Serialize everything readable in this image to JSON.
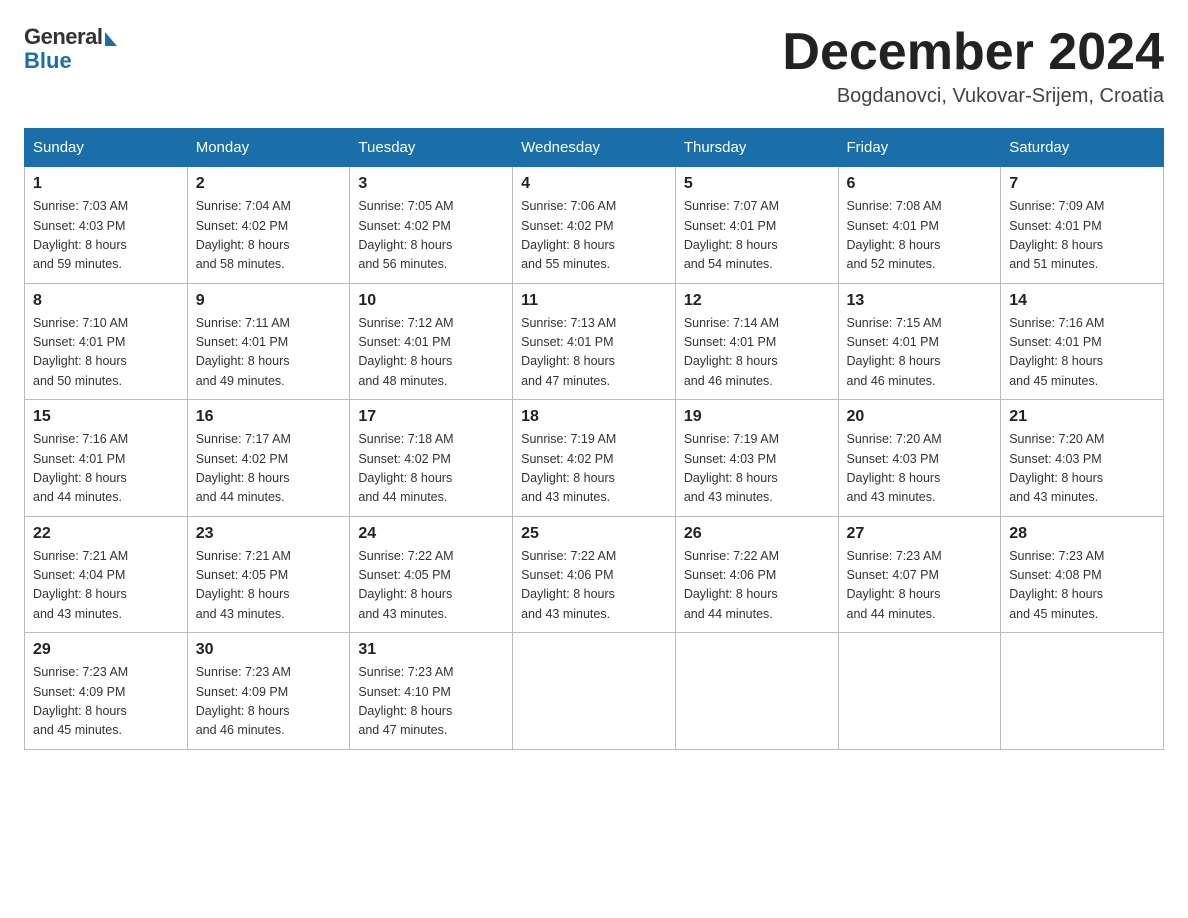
{
  "logo": {
    "general": "General",
    "blue": "Blue"
  },
  "header": {
    "month_year": "December 2024",
    "location": "Bogdanovci, Vukovar-Srijem, Croatia"
  },
  "days_of_week": [
    "Sunday",
    "Monday",
    "Tuesday",
    "Wednesday",
    "Thursday",
    "Friday",
    "Saturday"
  ],
  "weeks": [
    [
      {
        "day": "1",
        "sunrise": "7:03 AM",
        "sunset": "4:03 PM",
        "daylight": "8 hours and 59 minutes."
      },
      {
        "day": "2",
        "sunrise": "7:04 AM",
        "sunset": "4:02 PM",
        "daylight": "8 hours and 58 minutes."
      },
      {
        "day": "3",
        "sunrise": "7:05 AM",
        "sunset": "4:02 PM",
        "daylight": "8 hours and 56 minutes."
      },
      {
        "day": "4",
        "sunrise": "7:06 AM",
        "sunset": "4:02 PM",
        "daylight": "8 hours and 55 minutes."
      },
      {
        "day": "5",
        "sunrise": "7:07 AM",
        "sunset": "4:01 PM",
        "daylight": "8 hours and 54 minutes."
      },
      {
        "day": "6",
        "sunrise": "7:08 AM",
        "sunset": "4:01 PM",
        "daylight": "8 hours and 52 minutes."
      },
      {
        "day": "7",
        "sunrise": "7:09 AM",
        "sunset": "4:01 PM",
        "daylight": "8 hours and 51 minutes."
      }
    ],
    [
      {
        "day": "8",
        "sunrise": "7:10 AM",
        "sunset": "4:01 PM",
        "daylight": "8 hours and 50 minutes."
      },
      {
        "day": "9",
        "sunrise": "7:11 AM",
        "sunset": "4:01 PM",
        "daylight": "8 hours and 49 minutes."
      },
      {
        "day": "10",
        "sunrise": "7:12 AM",
        "sunset": "4:01 PM",
        "daylight": "8 hours and 48 minutes."
      },
      {
        "day": "11",
        "sunrise": "7:13 AM",
        "sunset": "4:01 PM",
        "daylight": "8 hours and 47 minutes."
      },
      {
        "day": "12",
        "sunrise": "7:14 AM",
        "sunset": "4:01 PM",
        "daylight": "8 hours and 46 minutes."
      },
      {
        "day": "13",
        "sunrise": "7:15 AM",
        "sunset": "4:01 PM",
        "daylight": "8 hours and 46 minutes."
      },
      {
        "day": "14",
        "sunrise": "7:16 AM",
        "sunset": "4:01 PM",
        "daylight": "8 hours and 45 minutes."
      }
    ],
    [
      {
        "day": "15",
        "sunrise": "7:16 AM",
        "sunset": "4:01 PM",
        "daylight": "8 hours and 44 minutes."
      },
      {
        "day": "16",
        "sunrise": "7:17 AM",
        "sunset": "4:02 PM",
        "daylight": "8 hours and 44 minutes."
      },
      {
        "day": "17",
        "sunrise": "7:18 AM",
        "sunset": "4:02 PM",
        "daylight": "8 hours and 44 minutes."
      },
      {
        "day": "18",
        "sunrise": "7:19 AM",
        "sunset": "4:02 PM",
        "daylight": "8 hours and 43 minutes."
      },
      {
        "day": "19",
        "sunrise": "7:19 AM",
        "sunset": "4:03 PM",
        "daylight": "8 hours and 43 minutes."
      },
      {
        "day": "20",
        "sunrise": "7:20 AM",
        "sunset": "4:03 PM",
        "daylight": "8 hours and 43 minutes."
      },
      {
        "day": "21",
        "sunrise": "7:20 AM",
        "sunset": "4:03 PM",
        "daylight": "8 hours and 43 minutes."
      }
    ],
    [
      {
        "day": "22",
        "sunrise": "7:21 AM",
        "sunset": "4:04 PM",
        "daylight": "8 hours and 43 minutes."
      },
      {
        "day": "23",
        "sunrise": "7:21 AM",
        "sunset": "4:05 PM",
        "daylight": "8 hours and 43 minutes."
      },
      {
        "day": "24",
        "sunrise": "7:22 AM",
        "sunset": "4:05 PM",
        "daylight": "8 hours and 43 minutes."
      },
      {
        "day": "25",
        "sunrise": "7:22 AM",
        "sunset": "4:06 PM",
        "daylight": "8 hours and 43 minutes."
      },
      {
        "day": "26",
        "sunrise": "7:22 AM",
        "sunset": "4:06 PM",
        "daylight": "8 hours and 44 minutes."
      },
      {
        "day": "27",
        "sunrise": "7:23 AM",
        "sunset": "4:07 PM",
        "daylight": "8 hours and 44 minutes."
      },
      {
        "day": "28",
        "sunrise": "7:23 AM",
        "sunset": "4:08 PM",
        "daylight": "8 hours and 45 minutes."
      }
    ],
    [
      {
        "day": "29",
        "sunrise": "7:23 AM",
        "sunset": "4:09 PM",
        "daylight": "8 hours and 45 minutes."
      },
      {
        "day": "30",
        "sunrise": "7:23 AM",
        "sunset": "4:09 PM",
        "daylight": "8 hours and 46 minutes."
      },
      {
        "day": "31",
        "sunrise": "7:23 AM",
        "sunset": "4:10 PM",
        "daylight": "8 hours and 47 minutes."
      },
      null,
      null,
      null,
      null
    ]
  ],
  "labels": {
    "sunrise": "Sunrise:",
    "sunset": "Sunset:",
    "daylight": "Daylight:"
  }
}
